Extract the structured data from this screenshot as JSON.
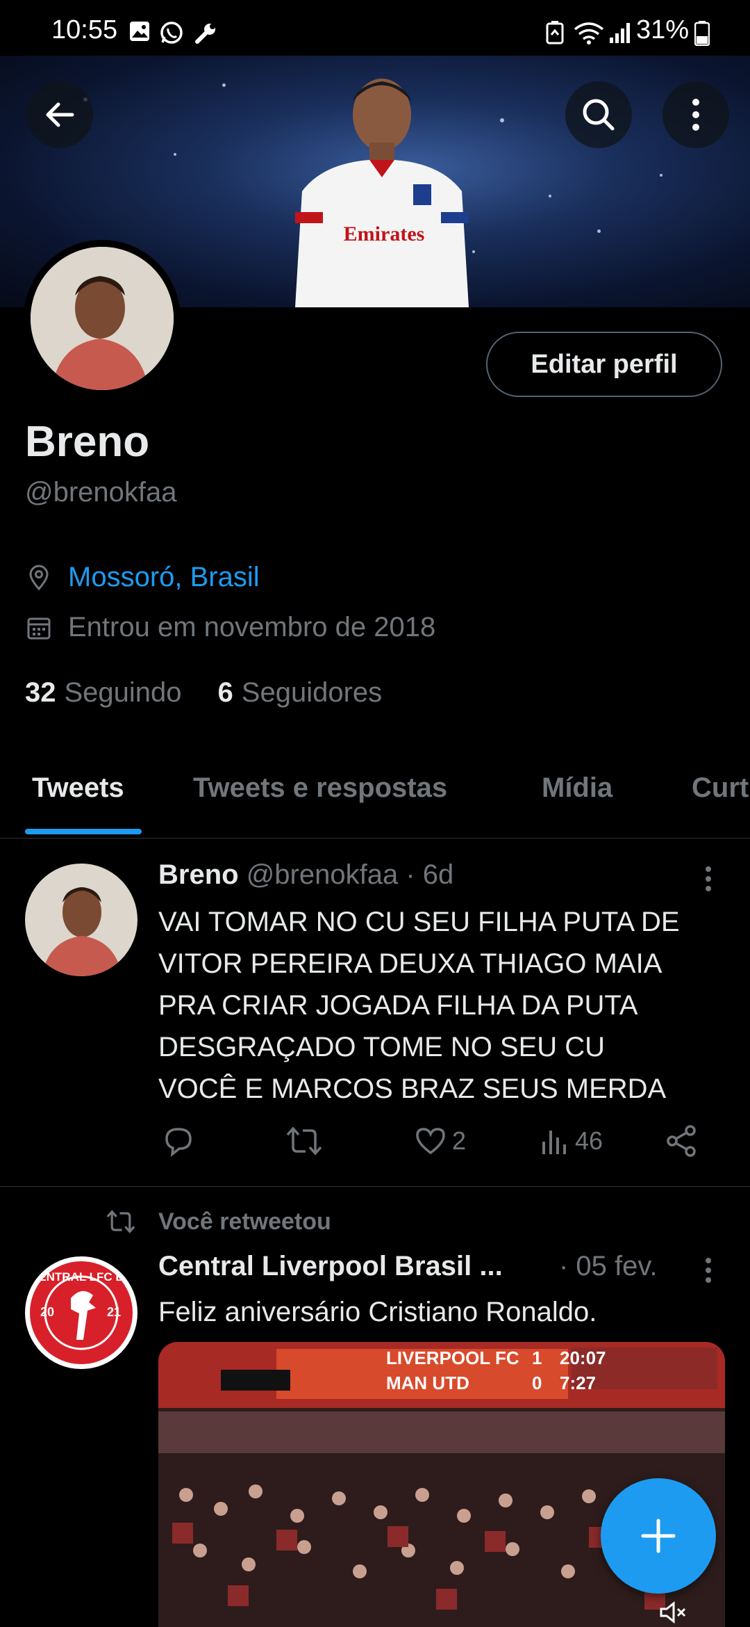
{
  "status_bar": {
    "time": "10:55",
    "battery": "31%"
  },
  "profile": {
    "name": "Breno",
    "handle": "@brenokfaa",
    "location": "Mossoró, Brasil",
    "joined": "Entrou em novembro de 2018",
    "following_count": "32",
    "following_label": "Seguindo",
    "followers_count": "6",
    "followers_label": "Seguidores",
    "edit_button": "Editar perfil"
  },
  "banner": {
    "shirt_text": "Emirates"
  },
  "tabs": [
    {
      "label": "Tweets",
      "active": true
    },
    {
      "label": "Tweets e respostas",
      "active": false
    },
    {
      "label": "Mídia",
      "active": false
    },
    {
      "label": "Curt",
      "active": false
    }
  ],
  "tweets": [
    {
      "name": "Breno",
      "handle": "@brenokfaa",
      "time": "· 6d",
      "lines": [
        "VAI TOMAR NO CU SEU FILHA PUTA DE",
        "VITOR PEREIRA DEUXA THIAGO MAIA",
        "PRA CRIAR JOGADA FILHA DA PUTA",
        "DESGRAÇADO TOME NO SEU CU",
        "VOCÊ E MARCOS BRAZ SEUS MERDA"
      ],
      "likes": "2",
      "views": "46"
    },
    {
      "retweet_label": "Você retweetou",
      "name": "Central Liverpool Brasil ...",
      "time": "· 05 fev.",
      "text": "Feliz aniversário Cristiano Ronaldo.",
      "avatar_text": "CENTRAL LFC BR",
      "avatar_years": [
        "20",
        "21"
      ],
      "media": {
        "scoreboard_home": "LIVERPOOL FC",
        "scoreboard_away": "MAN UTD",
        "home_score": "1",
        "away_score": "0",
        "home_time": "20:07",
        "away_time": "7:27"
      }
    }
  ],
  "colors": {
    "accent": "#1d9bf0",
    "background": "#000000",
    "muted": "#71767b",
    "divider": "#2f3336"
  },
  "icons": {
    "back": "arrow-left-icon",
    "search": "search-icon",
    "more": "more-vertical-icon",
    "location": "location-pin-icon",
    "calendar": "calendar-icon",
    "reply": "reply-icon",
    "retweet": "retweet-icon",
    "like": "heart-icon",
    "views": "views-icon",
    "share": "share-icon",
    "compose": "plus-icon"
  }
}
